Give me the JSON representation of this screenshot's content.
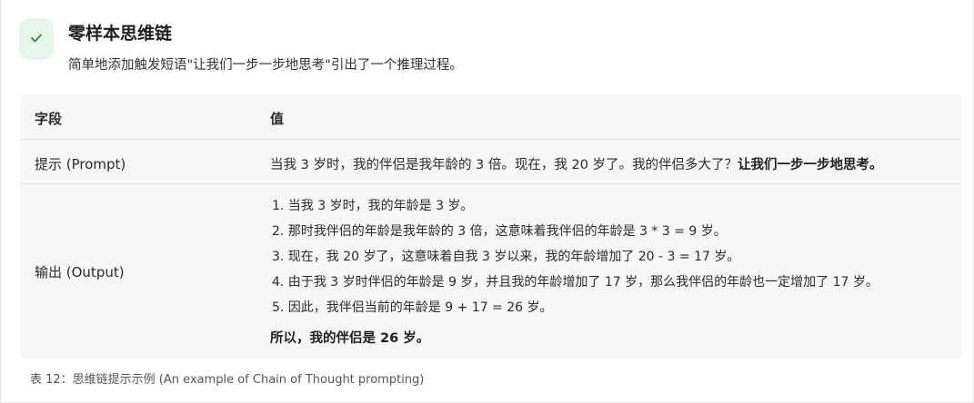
{
  "header": {
    "icon": "check-icon",
    "accent_color": "#2e8b3e",
    "title": "零样本思维链",
    "subtitle": "简单地添加触发短语\"让我们一步一步地思考\"引出了一个推理过程。"
  },
  "table": {
    "columns": [
      "字段",
      "值"
    ],
    "prompt_row": {
      "field": "提示 (Prompt)",
      "value": "当我 3 岁时，我的伴侣是我年龄的 3 倍。现在，我 20 岁了。我的伴侣多大了？",
      "value_bold": "让我们一步一步地思考。"
    },
    "output_row": {
      "field": "输出 (Output)",
      "steps": [
        "1. 当我 3 岁时，我的年龄是 3 岁。",
        "2. 那时我伴侣的年龄是我年龄的 3 倍，这意味着我伴侣的年龄是 3 * 3 = 9 岁。",
        "3. 现在，我 20 岁了，这意味着自我 3 岁以来，我的年龄增加了 20 - 3 = 17 岁。",
        "4. 由于我 3 岁时伴侣的年龄是 9 岁，并且我的年龄增加了 17 岁，那么我伴侣的年龄也一定增加了 17 岁。",
        "5. 因此，我伴侣当前的年龄是 9 + 17 = 26 岁。"
      ],
      "conclusion": "所以，我的伴侣是 26 岁。"
    }
  },
  "caption": "表 12：思维链提示示例 (An example of Chain of Thought prompting)"
}
